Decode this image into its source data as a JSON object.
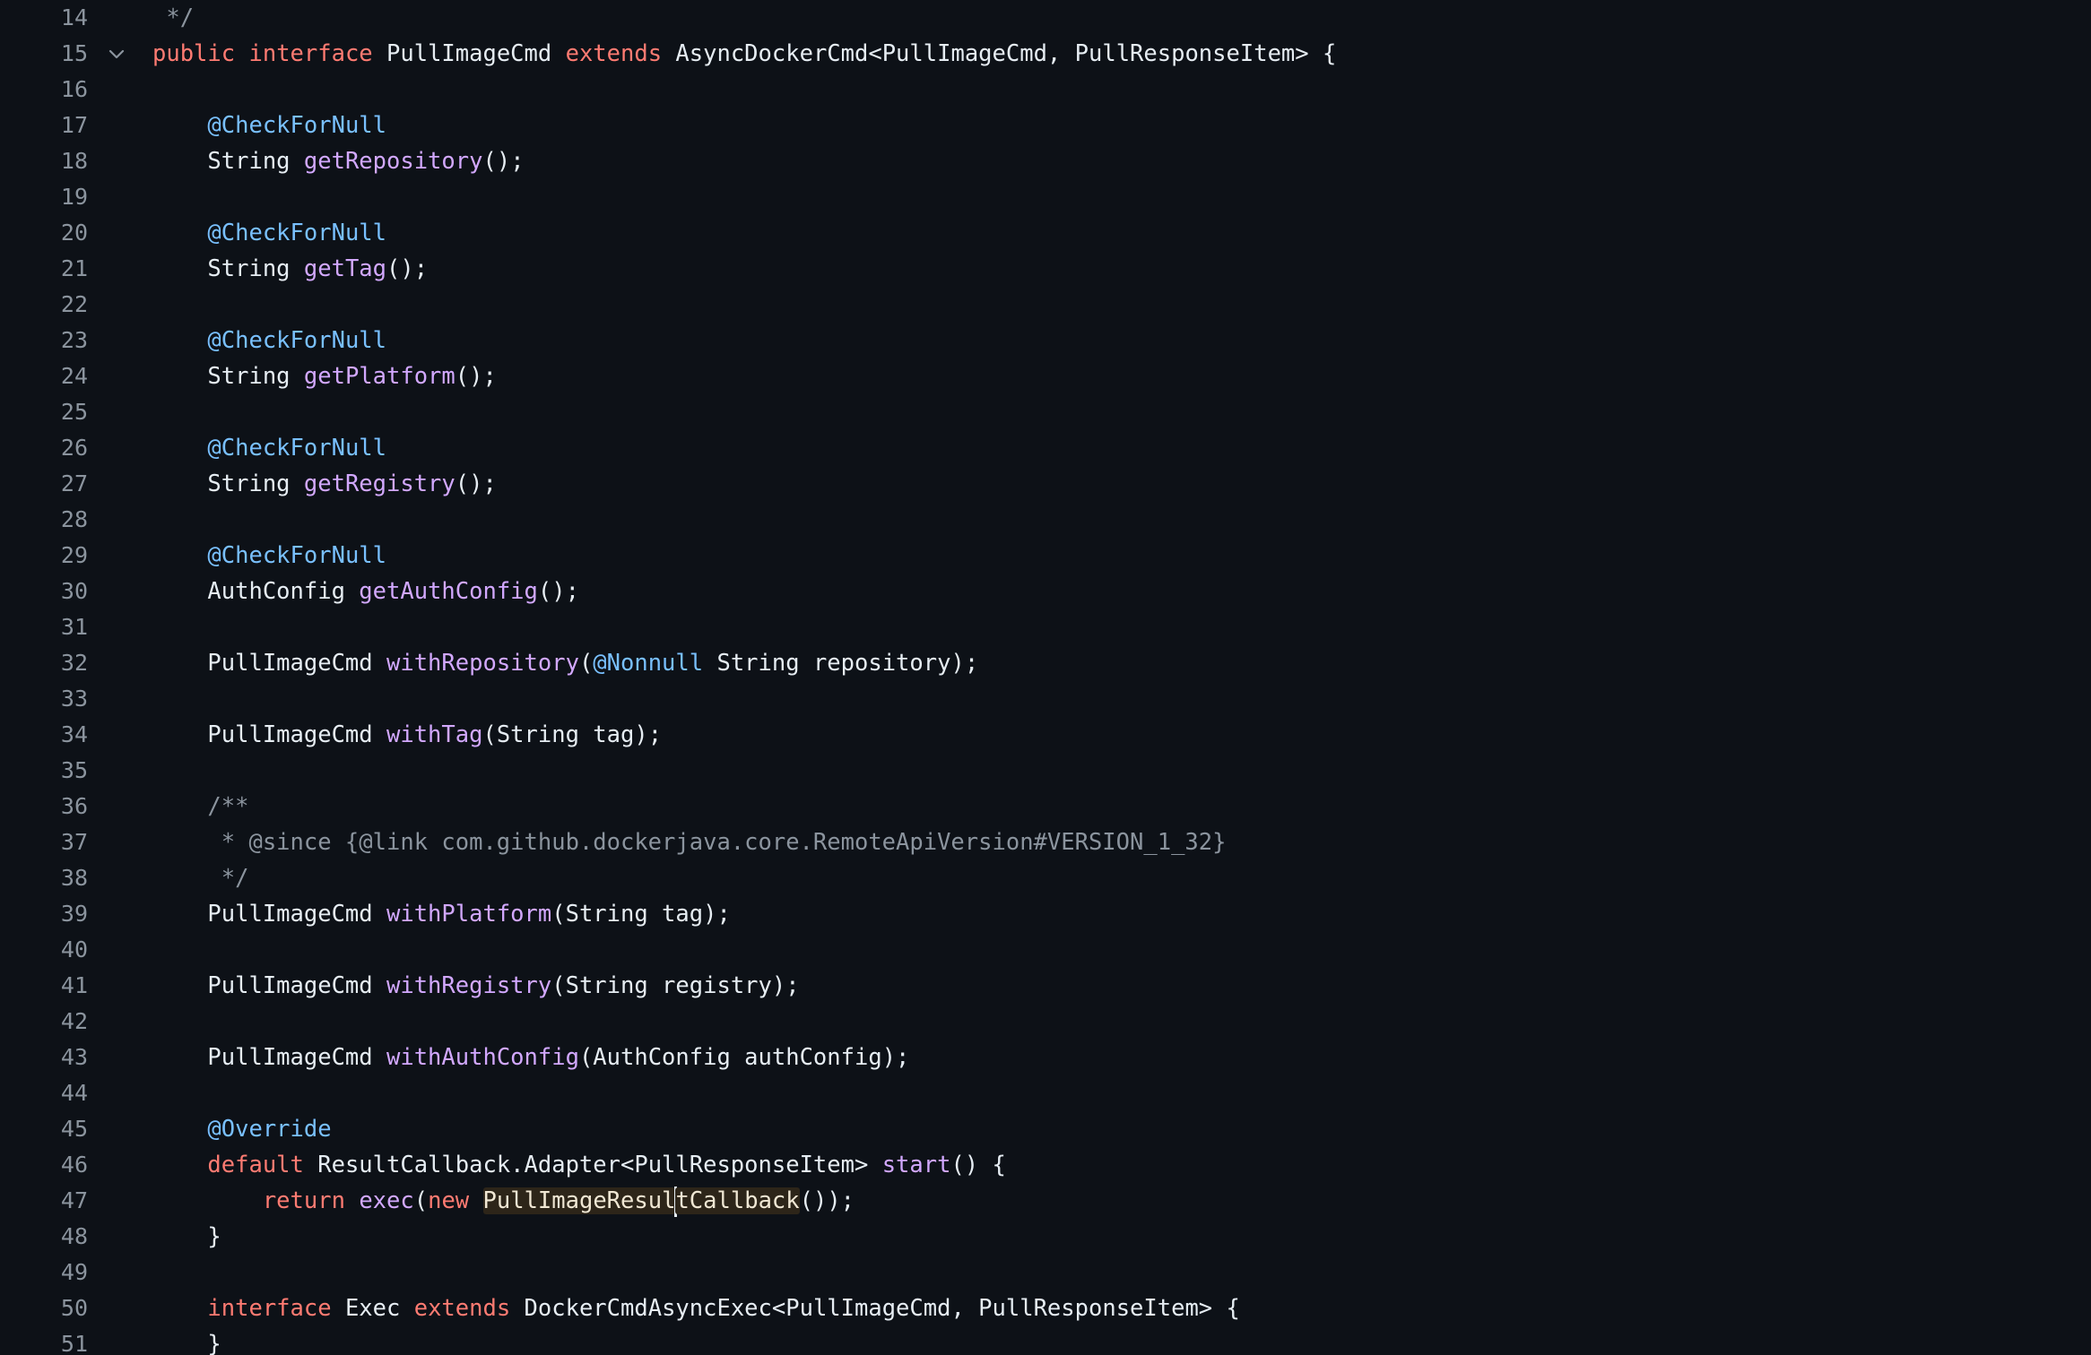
{
  "editor": {
    "fold_icon": "chevron-down-icon",
    "colors": {
      "background": "#0d1117",
      "line_number": "#8b949e",
      "plain": "#e6edf3",
      "keyword": "#ff7b72",
      "function": "#d2a8ff",
      "annotation": "#79c0ff",
      "comment": "#8b949e",
      "highlight": "#2d2519"
    },
    "lines": [
      {
        "number": "14",
        "tokens": [
          {
            "text": " */",
            "kind": "cm"
          }
        ]
      },
      {
        "number": "15",
        "fold": true,
        "tokens": [
          {
            "text": "public",
            "kind": "kw"
          },
          {
            "text": " ",
            "kind": "pl"
          },
          {
            "text": "interface",
            "kind": "kw"
          },
          {
            "text": " PullImageCmd ",
            "kind": "pl"
          },
          {
            "text": "extends",
            "kind": "kw"
          },
          {
            "text": " AsyncDockerCmd<PullImageCmd, PullResponseItem> {",
            "kind": "pl"
          }
        ]
      },
      {
        "number": "16",
        "tokens": []
      },
      {
        "number": "17",
        "tokens": [
          {
            "text": "    ",
            "kind": "pl"
          },
          {
            "text": "@CheckForNull",
            "kind": "an"
          }
        ]
      },
      {
        "number": "18",
        "tokens": [
          {
            "text": "    String ",
            "kind": "pl"
          },
          {
            "text": "getRepository",
            "kind": "fn"
          },
          {
            "text": "();",
            "kind": "pl"
          }
        ]
      },
      {
        "number": "19",
        "tokens": []
      },
      {
        "number": "20",
        "tokens": [
          {
            "text": "    ",
            "kind": "pl"
          },
          {
            "text": "@CheckForNull",
            "kind": "an"
          }
        ]
      },
      {
        "number": "21",
        "tokens": [
          {
            "text": "    String ",
            "kind": "pl"
          },
          {
            "text": "getTag",
            "kind": "fn"
          },
          {
            "text": "();",
            "kind": "pl"
          }
        ]
      },
      {
        "number": "22",
        "tokens": []
      },
      {
        "number": "23",
        "tokens": [
          {
            "text": "    ",
            "kind": "pl"
          },
          {
            "text": "@CheckForNull",
            "kind": "an"
          }
        ]
      },
      {
        "number": "24",
        "tokens": [
          {
            "text": "    String ",
            "kind": "pl"
          },
          {
            "text": "getPlatform",
            "kind": "fn"
          },
          {
            "text": "();",
            "kind": "pl"
          }
        ]
      },
      {
        "number": "25",
        "tokens": []
      },
      {
        "number": "26",
        "tokens": [
          {
            "text": "    ",
            "kind": "pl"
          },
          {
            "text": "@CheckForNull",
            "kind": "an"
          }
        ]
      },
      {
        "number": "27",
        "tokens": [
          {
            "text": "    String ",
            "kind": "pl"
          },
          {
            "text": "getRegistry",
            "kind": "fn"
          },
          {
            "text": "();",
            "kind": "pl"
          }
        ]
      },
      {
        "number": "28",
        "tokens": []
      },
      {
        "number": "29",
        "tokens": [
          {
            "text": "    ",
            "kind": "pl"
          },
          {
            "text": "@CheckForNull",
            "kind": "an"
          }
        ]
      },
      {
        "number": "30",
        "tokens": [
          {
            "text": "    AuthConfig ",
            "kind": "pl"
          },
          {
            "text": "getAuthConfig",
            "kind": "fn"
          },
          {
            "text": "();",
            "kind": "pl"
          }
        ]
      },
      {
        "number": "31",
        "tokens": []
      },
      {
        "number": "32",
        "tokens": [
          {
            "text": "    PullImageCmd ",
            "kind": "pl"
          },
          {
            "text": "withRepository",
            "kind": "fn"
          },
          {
            "text": "(",
            "kind": "pl"
          },
          {
            "text": "@Nonnull",
            "kind": "an"
          },
          {
            "text": " String repository);",
            "kind": "pl"
          }
        ]
      },
      {
        "number": "33",
        "tokens": []
      },
      {
        "number": "34",
        "tokens": [
          {
            "text": "    PullImageCmd ",
            "kind": "pl"
          },
          {
            "text": "withTag",
            "kind": "fn"
          },
          {
            "text": "(String tag);",
            "kind": "pl"
          }
        ]
      },
      {
        "number": "35",
        "tokens": []
      },
      {
        "number": "36",
        "tokens": [
          {
            "text": "    /**",
            "kind": "cm"
          }
        ]
      },
      {
        "number": "37",
        "tokens": [
          {
            "text": "     * @since {@link com.github.dockerjava.core.RemoteApiVersion#VERSION_1_32}",
            "kind": "cm"
          }
        ]
      },
      {
        "number": "38",
        "tokens": [
          {
            "text": "     */",
            "kind": "cm"
          }
        ]
      },
      {
        "number": "39",
        "tokens": [
          {
            "text": "    PullImageCmd ",
            "kind": "pl"
          },
          {
            "text": "withPlatform",
            "kind": "fn"
          },
          {
            "text": "(String tag);",
            "kind": "pl"
          }
        ]
      },
      {
        "number": "40",
        "tokens": []
      },
      {
        "number": "41",
        "tokens": [
          {
            "text": "    PullImageCmd ",
            "kind": "pl"
          },
          {
            "text": "withRegistry",
            "kind": "fn"
          },
          {
            "text": "(String registry);",
            "kind": "pl"
          }
        ]
      },
      {
        "number": "42",
        "tokens": []
      },
      {
        "number": "43",
        "tokens": [
          {
            "text": "    PullImageCmd ",
            "kind": "pl"
          },
          {
            "text": "withAuthConfig",
            "kind": "fn"
          },
          {
            "text": "(AuthConfig authConfig);",
            "kind": "pl"
          }
        ]
      },
      {
        "number": "44",
        "tokens": []
      },
      {
        "number": "45",
        "tokens": [
          {
            "text": "    ",
            "kind": "pl"
          },
          {
            "text": "@Override",
            "kind": "an"
          }
        ]
      },
      {
        "number": "46",
        "tokens": [
          {
            "text": "    ",
            "kind": "pl"
          },
          {
            "text": "default",
            "kind": "kw"
          },
          {
            "text": " ResultCallback.Adapter<PullResponseItem> ",
            "kind": "pl"
          },
          {
            "text": "start",
            "kind": "fn"
          },
          {
            "text": "() {",
            "kind": "pl"
          }
        ]
      },
      {
        "number": "47",
        "tokens": [
          {
            "text": "        ",
            "kind": "pl"
          },
          {
            "text": "return",
            "kind": "kw"
          },
          {
            "text": " ",
            "kind": "pl"
          },
          {
            "text": "exec",
            "kind": "fn"
          },
          {
            "text": "(",
            "kind": "pl"
          },
          {
            "text": "new",
            "kind": "kw"
          },
          {
            "text": " ",
            "kind": "pl"
          },
          {
            "text": "PullImageResul",
            "kind": "hl"
          },
          {
            "text": "",
            "kind": "cursor"
          },
          {
            "text": "tCallback",
            "kind": "hl"
          },
          {
            "text": "());",
            "kind": "pl"
          }
        ]
      },
      {
        "number": "48",
        "tokens": [
          {
            "text": "    }",
            "kind": "pl"
          }
        ]
      },
      {
        "number": "49",
        "tokens": []
      },
      {
        "number": "50",
        "tokens": [
          {
            "text": "    ",
            "kind": "pl"
          },
          {
            "text": "interface",
            "kind": "kw"
          },
          {
            "text": " Exec ",
            "kind": "pl"
          },
          {
            "text": "extends",
            "kind": "kw"
          },
          {
            "text": " DockerCmdAsyncExec<PullImageCmd, PullResponseItem> {",
            "kind": "pl"
          }
        ]
      },
      {
        "number": "51",
        "tokens": [
          {
            "text": "    }",
            "kind": "pl"
          }
        ]
      }
    ]
  }
}
